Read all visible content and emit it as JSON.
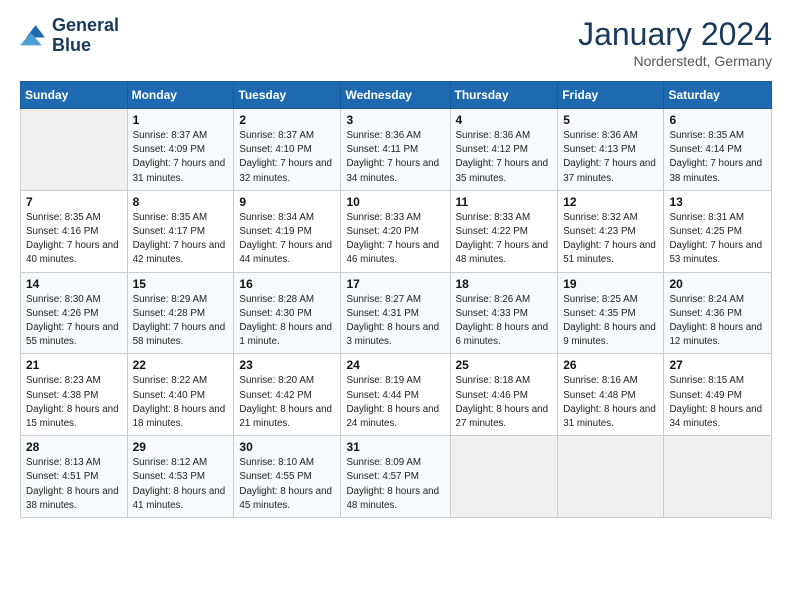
{
  "logo": {
    "line1": "General",
    "line2": "Blue"
  },
  "title": "January 2024",
  "location": "Norderstedt, Germany",
  "days_header": [
    "Sunday",
    "Monday",
    "Tuesday",
    "Wednesday",
    "Thursday",
    "Friday",
    "Saturday"
  ],
  "weeks": [
    [
      {
        "num": "",
        "sunrise": "",
        "sunset": "",
        "daylight": ""
      },
      {
        "num": "1",
        "sunrise": "Sunrise: 8:37 AM",
        "sunset": "Sunset: 4:09 PM",
        "daylight": "Daylight: 7 hours and 31 minutes."
      },
      {
        "num": "2",
        "sunrise": "Sunrise: 8:37 AM",
        "sunset": "Sunset: 4:10 PM",
        "daylight": "Daylight: 7 hours and 32 minutes."
      },
      {
        "num": "3",
        "sunrise": "Sunrise: 8:36 AM",
        "sunset": "Sunset: 4:11 PM",
        "daylight": "Daylight: 7 hours and 34 minutes."
      },
      {
        "num": "4",
        "sunrise": "Sunrise: 8:36 AM",
        "sunset": "Sunset: 4:12 PM",
        "daylight": "Daylight: 7 hours and 35 minutes."
      },
      {
        "num": "5",
        "sunrise": "Sunrise: 8:36 AM",
        "sunset": "Sunset: 4:13 PM",
        "daylight": "Daylight: 7 hours and 37 minutes."
      },
      {
        "num": "6",
        "sunrise": "Sunrise: 8:35 AM",
        "sunset": "Sunset: 4:14 PM",
        "daylight": "Daylight: 7 hours and 38 minutes."
      }
    ],
    [
      {
        "num": "7",
        "sunrise": "Sunrise: 8:35 AM",
        "sunset": "Sunset: 4:16 PM",
        "daylight": "Daylight: 7 hours and 40 minutes."
      },
      {
        "num": "8",
        "sunrise": "Sunrise: 8:35 AM",
        "sunset": "Sunset: 4:17 PM",
        "daylight": "Daylight: 7 hours and 42 minutes."
      },
      {
        "num": "9",
        "sunrise": "Sunrise: 8:34 AM",
        "sunset": "Sunset: 4:19 PM",
        "daylight": "Daylight: 7 hours and 44 minutes."
      },
      {
        "num": "10",
        "sunrise": "Sunrise: 8:33 AM",
        "sunset": "Sunset: 4:20 PM",
        "daylight": "Daylight: 7 hours and 46 minutes."
      },
      {
        "num": "11",
        "sunrise": "Sunrise: 8:33 AM",
        "sunset": "Sunset: 4:22 PM",
        "daylight": "Daylight: 7 hours and 48 minutes."
      },
      {
        "num": "12",
        "sunrise": "Sunrise: 8:32 AM",
        "sunset": "Sunset: 4:23 PM",
        "daylight": "Daylight: 7 hours and 51 minutes."
      },
      {
        "num": "13",
        "sunrise": "Sunrise: 8:31 AM",
        "sunset": "Sunset: 4:25 PM",
        "daylight": "Daylight: 7 hours and 53 minutes."
      }
    ],
    [
      {
        "num": "14",
        "sunrise": "Sunrise: 8:30 AM",
        "sunset": "Sunset: 4:26 PM",
        "daylight": "Daylight: 7 hours and 55 minutes."
      },
      {
        "num": "15",
        "sunrise": "Sunrise: 8:29 AM",
        "sunset": "Sunset: 4:28 PM",
        "daylight": "Daylight: 7 hours and 58 minutes."
      },
      {
        "num": "16",
        "sunrise": "Sunrise: 8:28 AM",
        "sunset": "Sunset: 4:30 PM",
        "daylight": "Daylight: 8 hours and 1 minute."
      },
      {
        "num": "17",
        "sunrise": "Sunrise: 8:27 AM",
        "sunset": "Sunset: 4:31 PM",
        "daylight": "Daylight: 8 hours and 3 minutes."
      },
      {
        "num": "18",
        "sunrise": "Sunrise: 8:26 AM",
        "sunset": "Sunset: 4:33 PM",
        "daylight": "Daylight: 8 hours and 6 minutes."
      },
      {
        "num": "19",
        "sunrise": "Sunrise: 8:25 AM",
        "sunset": "Sunset: 4:35 PM",
        "daylight": "Daylight: 8 hours and 9 minutes."
      },
      {
        "num": "20",
        "sunrise": "Sunrise: 8:24 AM",
        "sunset": "Sunset: 4:36 PM",
        "daylight": "Daylight: 8 hours and 12 minutes."
      }
    ],
    [
      {
        "num": "21",
        "sunrise": "Sunrise: 8:23 AM",
        "sunset": "Sunset: 4:38 PM",
        "daylight": "Daylight: 8 hours and 15 minutes."
      },
      {
        "num": "22",
        "sunrise": "Sunrise: 8:22 AM",
        "sunset": "Sunset: 4:40 PM",
        "daylight": "Daylight: 8 hours and 18 minutes."
      },
      {
        "num": "23",
        "sunrise": "Sunrise: 8:20 AM",
        "sunset": "Sunset: 4:42 PM",
        "daylight": "Daylight: 8 hours and 21 minutes."
      },
      {
        "num": "24",
        "sunrise": "Sunrise: 8:19 AM",
        "sunset": "Sunset: 4:44 PM",
        "daylight": "Daylight: 8 hours and 24 minutes."
      },
      {
        "num": "25",
        "sunrise": "Sunrise: 8:18 AM",
        "sunset": "Sunset: 4:46 PM",
        "daylight": "Daylight: 8 hours and 27 minutes."
      },
      {
        "num": "26",
        "sunrise": "Sunrise: 8:16 AM",
        "sunset": "Sunset: 4:48 PM",
        "daylight": "Daylight: 8 hours and 31 minutes."
      },
      {
        "num": "27",
        "sunrise": "Sunrise: 8:15 AM",
        "sunset": "Sunset: 4:49 PM",
        "daylight": "Daylight: 8 hours and 34 minutes."
      }
    ],
    [
      {
        "num": "28",
        "sunrise": "Sunrise: 8:13 AM",
        "sunset": "Sunset: 4:51 PM",
        "daylight": "Daylight: 8 hours and 38 minutes."
      },
      {
        "num": "29",
        "sunrise": "Sunrise: 8:12 AM",
        "sunset": "Sunset: 4:53 PM",
        "daylight": "Daylight: 8 hours and 41 minutes."
      },
      {
        "num": "30",
        "sunrise": "Sunrise: 8:10 AM",
        "sunset": "Sunset: 4:55 PM",
        "daylight": "Daylight: 8 hours and 45 minutes."
      },
      {
        "num": "31",
        "sunrise": "Sunrise: 8:09 AM",
        "sunset": "Sunset: 4:57 PM",
        "daylight": "Daylight: 8 hours and 48 minutes."
      },
      {
        "num": "",
        "sunrise": "",
        "sunset": "",
        "daylight": ""
      },
      {
        "num": "",
        "sunrise": "",
        "sunset": "",
        "daylight": ""
      },
      {
        "num": "",
        "sunrise": "",
        "sunset": "",
        "daylight": ""
      }
    ]
  ]
}
